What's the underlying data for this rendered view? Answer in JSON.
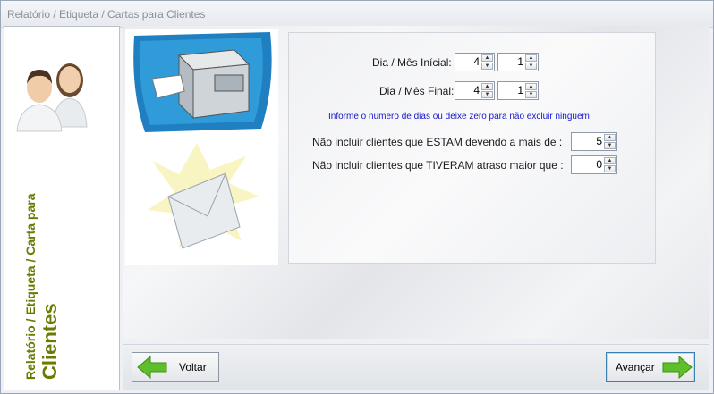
{
  "window": {
    "title": "Relatório / Etiqueta / Cartas para Clientes"
  },
  "sidebar": {
    "icon": "people-icon",
    "title_line1": "Relatório / Etiqueta / Carta para",
    "title_line2": "Clientes"
  },
  "images": {
    "printer": "printer-icon",
    "mail": "envelope-icon"
  },
  "form": {
    "start_label": "Dia / Mês Inícial:",
    "start_day": "4",
    "start_month": "1",
    "end_label": "Dia / Mês Final:",
    "end_day": "4",
    "end_month": "1",
    "info_text": "Informe o numero de dias ou deixe zero para não excluir ninguem",
    "owing_label": "Não incluir clientes que ESTAM devendo a mais de :",
    "owing_value": "5",
    "late_label": "Não incluir clientes que TIVERAM atraso maior que :",
    "late_value": "0"
  },
  "buttons": {
    "back_label": "Voltar",
    "next_label": "Avançar"
  },
  "colors": {
    "accent": "#6b7a00",
    "info": "#1515cc",
    "arrow_green": "#5fbf2a"
  }
}
